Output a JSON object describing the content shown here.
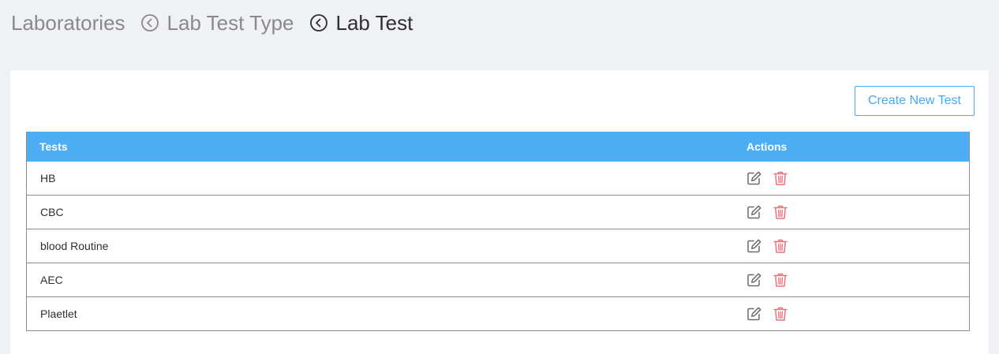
{
  "breadcrumb": {
    "items": [
      {
        "label": "Laboratories",
        "icon": "chevron-left-circle-icon"
      },
      {
        "label": "Lab Test Type",
        "icon": "chevron-left-circle-icon"
      },
      {
        "label": "Lab Test"
      }
    ]
  },
  "panel": {
    "create_button_label": "Create New Test"
  },
  "table": {
    "columns": [
      "Tests",
      "Actions"
    ],
    "rows": [
      {
        "name": "HB"
      },
      {
        "name": "CBC"
      },
      {
        "name": "blood Routine"
      },
      {
        "name": "AEC"
      },
      {
        "name": "Plaetlet"
      }
    ],
    "actions": [
      {
        "icon": "edit-icon"
      },
      {
        "icon": "trash-icon"
      }
    ]
  },
  "colors": {
    "accent": "#4daef4",
    "button_border": "#4aa8ee",
    "delete": "#e8737f",
    "edit": "#6b6b6b",
    "background": "#f0f1f4"
  }
}
